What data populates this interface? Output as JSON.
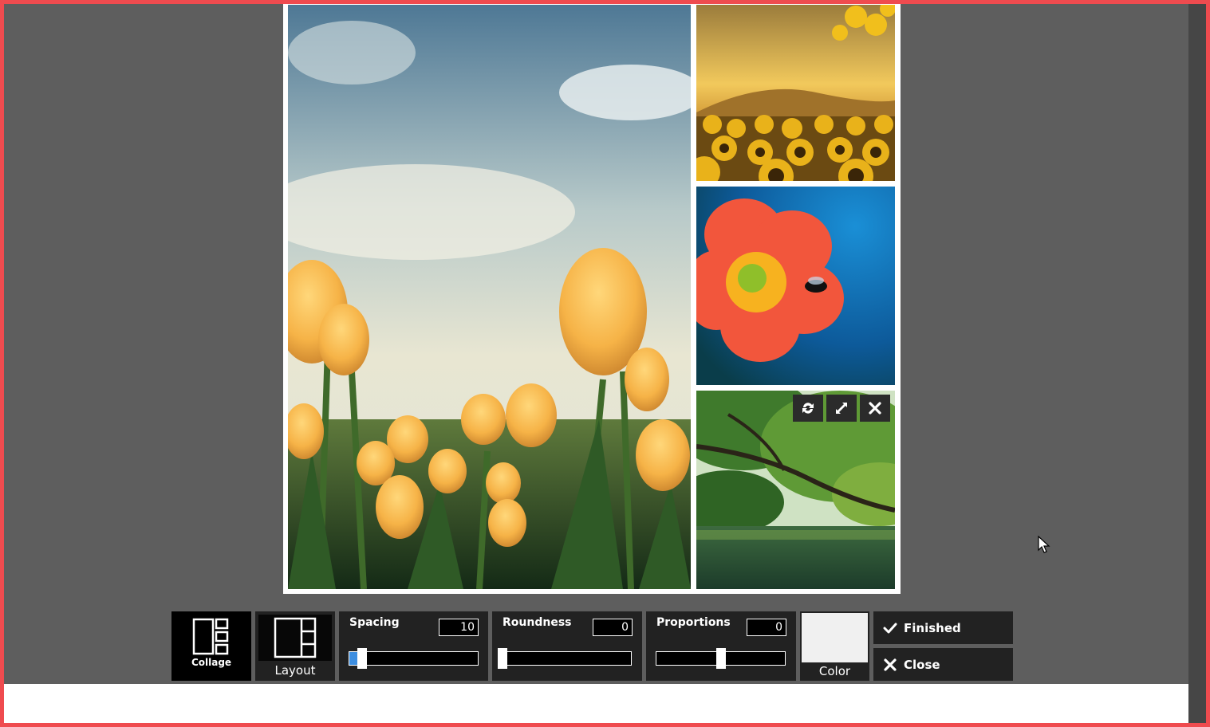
{
  "app": {
    "accent_color": "#3d8ee0",
    "frame_border_color": "#ef4b4f"
  },
  "collage": {
    "background_color": "#ffffff",
    "cells": [
      {
        "image": "tulip-field-photo"
      },
      {
        "image": "sunflower-field-photo"
      },
      {
        "image": "red-flower-with-bee-photo"
      },
      {
        "image": "river-tree-photo"
      }
    ],
    "cell_actions": [
      {
        "icon": "swap-icon"
      },
      {
        "icon": "resize-icon"
      },
      {
        "icon": "close-icon"
      }
    ]
  },
  "toolbar": {
    "collage": {
      "label": "Collage",
      "icon": "collage-icon"
    },
    "layout": {
      "label": "Layout",
      "icon": "layout-grid-icon"
    },
    "spacing": {
      "label": "Spacing",
      "value": "10",
      "fraction": 0.1
    },
    "roundness": {
      "label": "Roundness",
      "value": "0",
      "fraction": 0.0
    },
    "proportions": {
      "label": "Proportions",
      "value": "0",
      "fraction": 0.5
    },
    "color": {
      "label": "Color",
      "swatch": "#f0f0f0"
    },
    "finished": {
      "label": "Finished",
      "icon": "checkmark-icon"
    },
    "close": {
      "label": "Close",
      "icon": "close-icon"
    }
  }
}
